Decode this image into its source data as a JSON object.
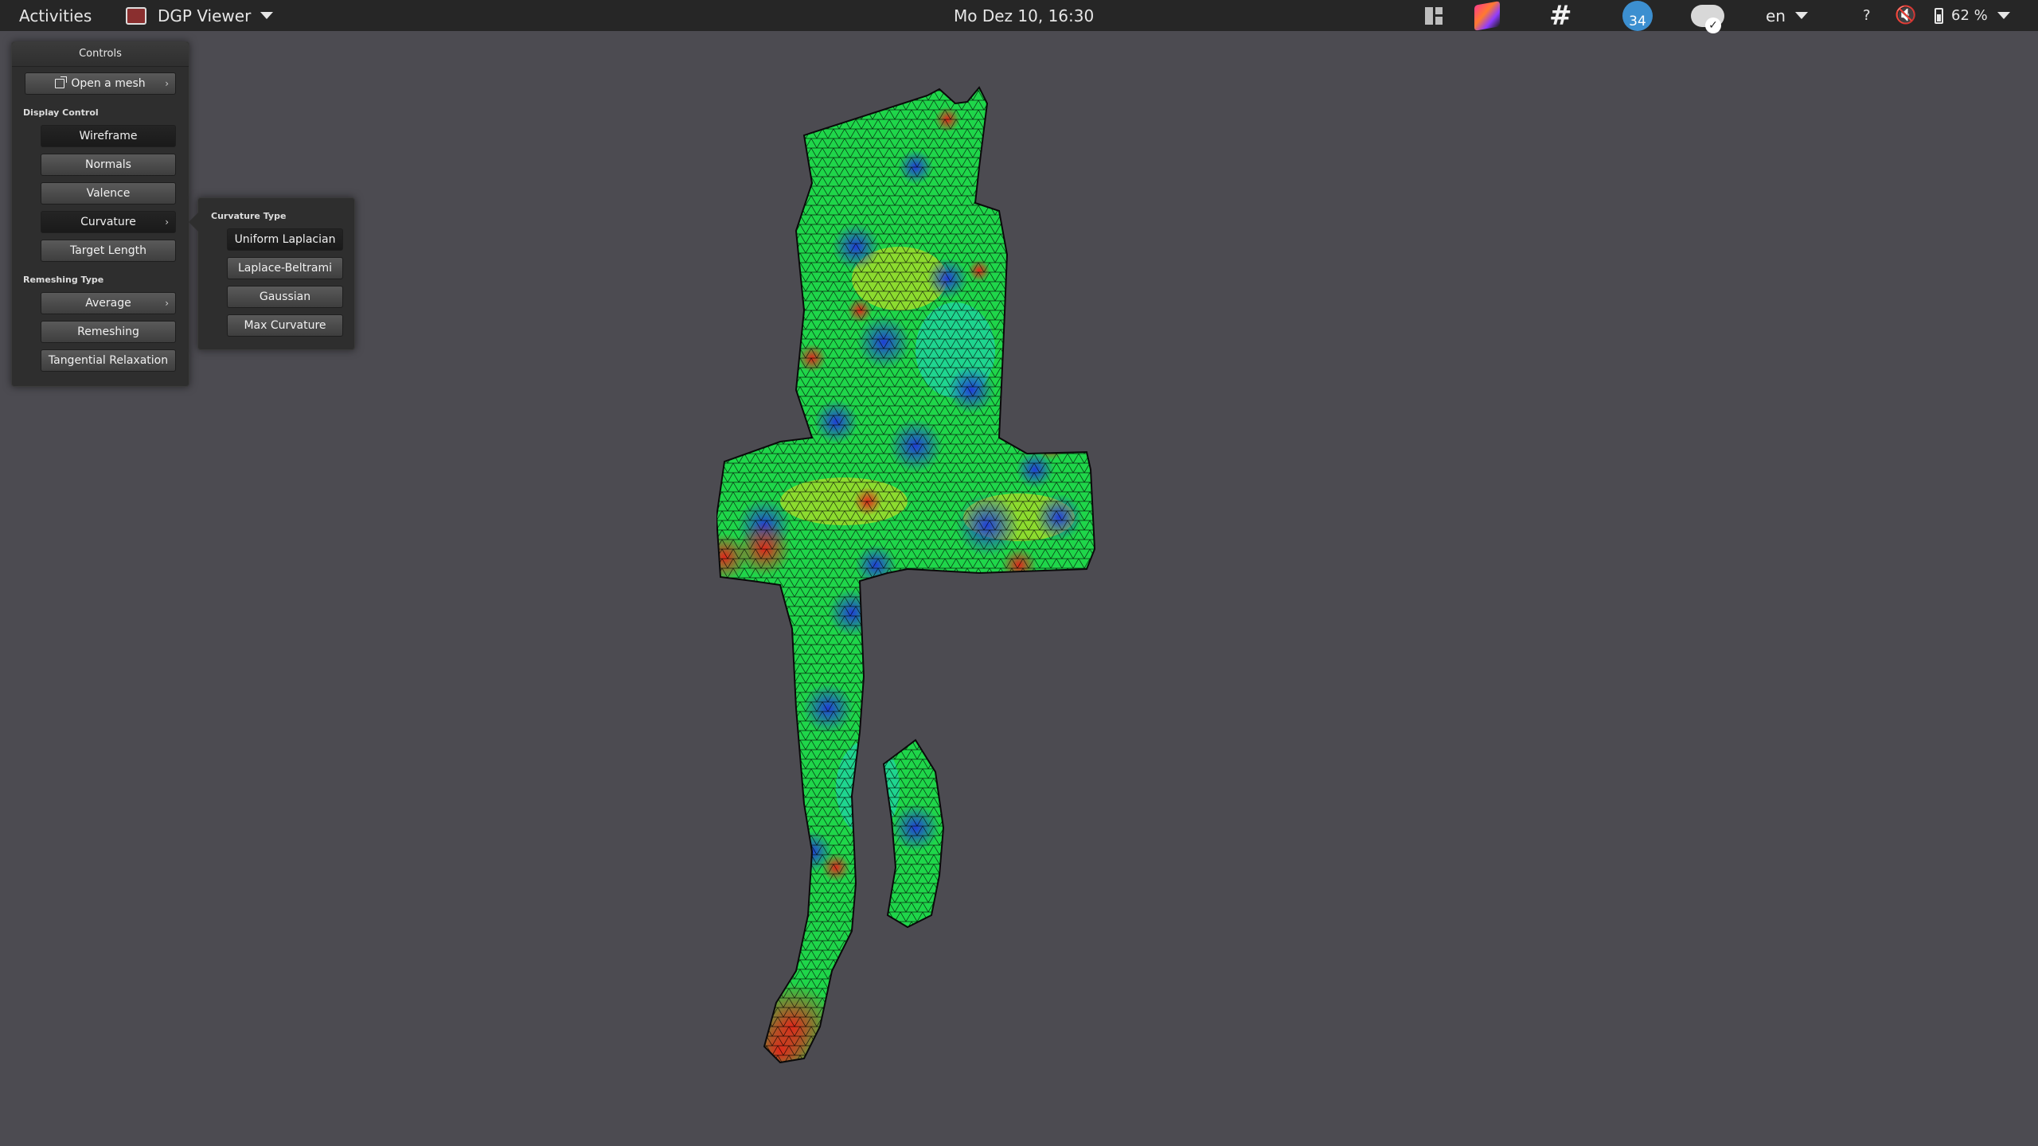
{
  "topbar": {
    "activities": "Activities",
    "app_name": "DGP Viewer",
    "clock": "Mo Dez 10, 16:30",
    "slack_glyph": "#",
    "notification_count": "34",
    "language": "en",
    "help": "?",
    "volume_glyph": "🔇",
    "battery": "62 %"
  },
  "panel": {
    "title": "Controls",
    "open_mesh": "Open a mesh",
    "display_control_label": "Display Control",
    "wireframe": "Wireframe",
    "normals": "Normals",
    "valence": "Valence",
    "curvature": "Curvature",
    "target_length": "Target Length",
    "remeshing_type_label": "Remeshing Type",
    "average": "Average",
    "remeshing": "Remeshing",
    "tangential_relaxation": "Tangential Relaxation",
    "arrow": "›"
  },
  "curvature_popup": {
    "title": "Curvature Type",
    "options": [
      "Uniform Laplacian",
      "Laplace-Beltrami",
      "Gaussian",
      "Max Curvature"
    ]
  },
  "colors": {
    "background": "#4c4b51",
    "mesh_green": "#1fd64a",
    "mesh_blue": "#1f3fd6",
    "mesh_red": "#e0281a",
    "mesh_yellow": "#e6e01a"
  }
}
